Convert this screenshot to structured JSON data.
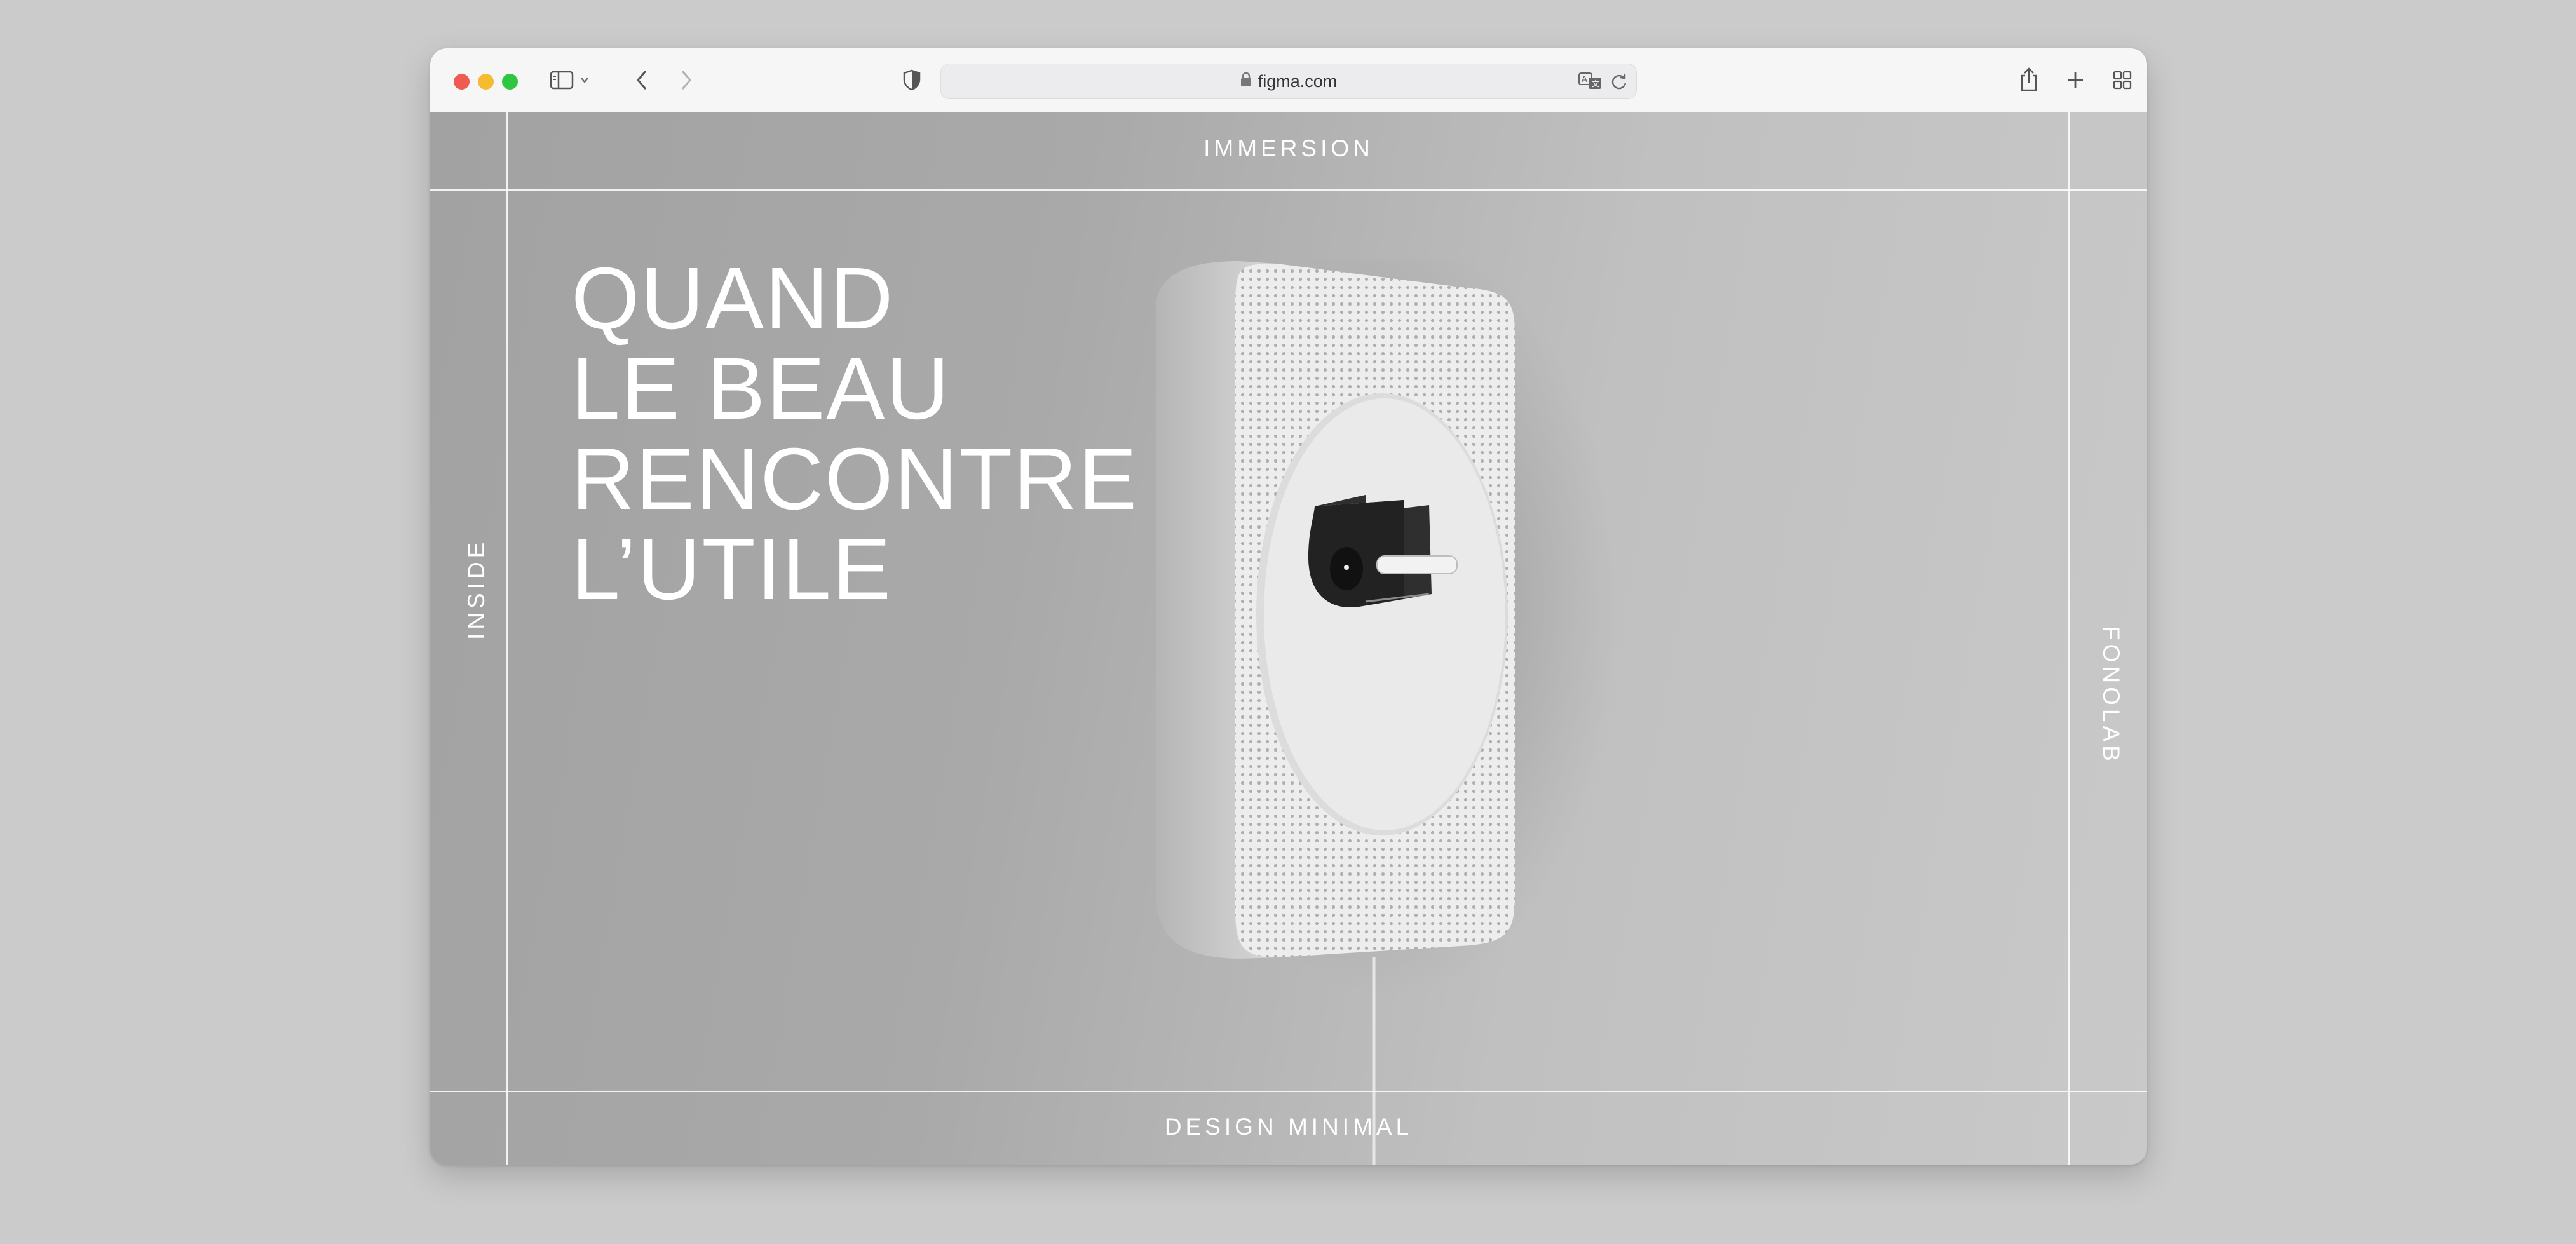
{
  "browser": {
    "url": "figma.com",
    "colors": {
      "close": "#ee5b52",
      "minimize": "#f4bd31",
      "maximize": "#2fc742"
    },
    "icons": [
      "sidebar-icon",
      "chevron-down-icon",
      "back-icon",
      "forward-icon",
      "shield-icon",
      "lock-icon",
      "translate-icon",
      "reload-icon",
      "share-icon",
      "new-tab-icon",
      "tab-overview-icon"
    ]
  },
  "page": {
    "top_label": "IMMERSION",
    "bottom_label": "DESIGN MINIMAL",
    "left_label": "INSIDE",
    "right_label": "FONOLAB",
    "headline": [
      "QUAND",
      "LE BEAU",
      "RENCONTRE",
      "L’UTILE"
    ]
  }
}
